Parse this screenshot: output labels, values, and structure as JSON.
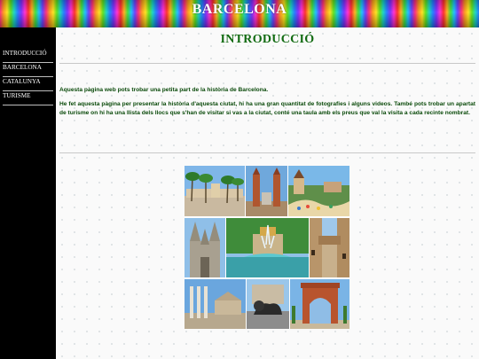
{
  "header": {
    "title": "BARCELONA"
  },
  "sidebar": {
    "items": [
      {
        "label": "INTRODUCCIÓ"
      },
      {
        "label": "BARCELONA"
      },
      {
        "label": "CATALUNYA"
      },
      {
        "label": "TURISME"
      }
    ]
  },
  "main": {
    "title": "INTRODUCCIÓ",
    "paragraph_1": "Aquesta pàgina web pots trobar una petita part de la història de Barcelona.",
    "paragraph_2": "He fet aquesta pàgina per presentar la història d'aquesta ciutat, hi ha una gran quantitat de fotografies i alguns videos. També pots trobar un apartat de turisme on hi ha una llista dels llocs que s'han de visitar si vas a la ciutat, conté una taula amb els preus que val la visita a cada recinte nombrat."
  },
  "colors": {
    "title_green": "#126b12",
    "text_green": "#0a4a0a",
    "sidebar_bg": "#000000",
    "sidebar_text": "#ffffff"
  },
  "collage": {
    "tiles": [
      "plaza-palm-trees-photo",
      "venetian-towers-photo",
      "park-guell-photo",
      "cathedral-photo",
      "cascada-fountain-photo",
      "narrow-street-bridge-photo",
      "montjuic-columns-photo",
      "lion-statue-photo",
      "arc-de-triomf-photo"
    ]
  }
}
